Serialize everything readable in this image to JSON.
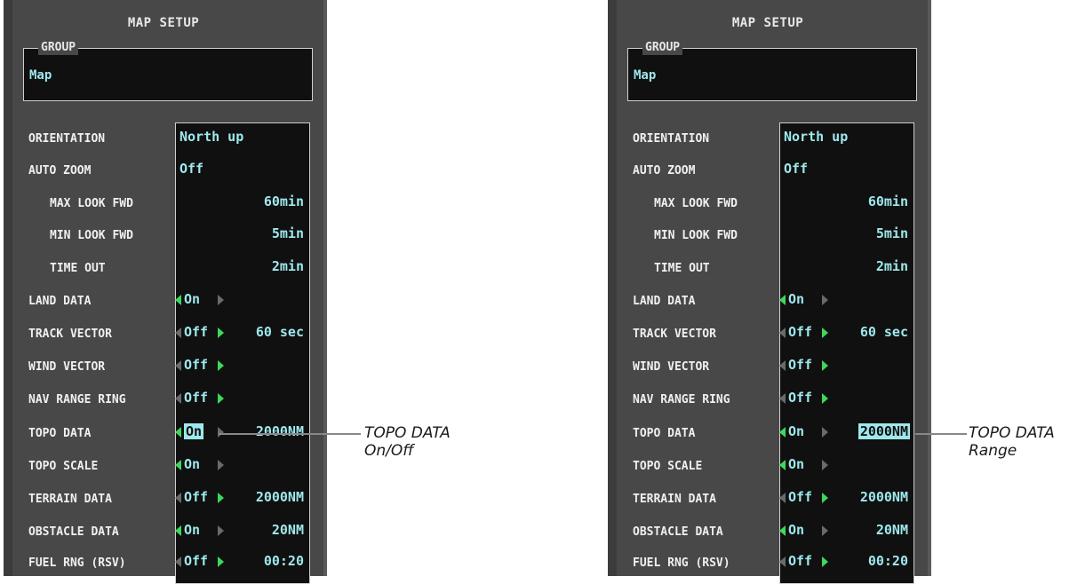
{
  "panels": [
    {
      "title": "MAP SETUP",
      "group_label": "GROUP",
      "group_value": "Map",
      "highlight": "topo_on",
      "rows": [
        {
          "label": "ORIENTATION",
          "value": "North up"
        },
        {
          "label": "AUTO ZOOM",
          "value": "Off"
        },
        {
          "label": "MAX LOOK FWD",
          "value": "60min"
        },
        {
          "label": "MIN LOOK FWD",
          "value": "5min"
        },
        {
          "label": "TIME OUT",
          "value": "2min"
        },
        {
          "label": "LAND DATA",
          "value": "On"
        },
        {
          "label": "TRACK VECTOR",
          "value": "Off",
          "range": "60 sec"
        },
        {
          "label": "WIND VECTOR",
          "value": "Off"
        },
        {
          "label": "NAV RANGE RING",
          "value": "Off"
        },
        {
          "label": "TOPO DATA",
          "value": "On",
          "range": "2000NM"
        },
        {
          "label": "TOPO SCALE",
          "value": "On"
        },
        {
          "label": "TERRAIN DATA",
          "value": "Off",
          "range": "2000NM"
        },
        {
          "label": "OBSTACLE DATA",
          "value": "On",
          "range": "20NM"
        },
        {
          "label": "FUEL RNG (RSV)",
          "value": "Off",
          "range": "00:20"
        }
      ],
      "callout_line1": "TOPO DATA",
      "callout_line2": "On/Off"
    },
    {
      "title": "MAP SETUP",
      "group_label": "GROUP",
      "group_value": "Map",
      "highlight": "topo_range",
      "rows": [
        {
          "label": "ORIENTATION",
          "value": "North up"
        },
        {
          "label": "AUTO ZOOM",
          "value": "Off"
        },
        {
          "label": "MAX LOOK FWD",
          "value": "60min"
        },
        {
          "label": "MIN LOOK FWD",
          "value": "5min"
        },
        {
          "label": "TIME OUT",
          "value": "2min"
        },
        {
          "label": "LAND DATA",
          "value": "On"
        },
        {
          "label": "TRACK VECTOR",
          "value": "Off",
          "range": "60 sec"
        },
        {
          "label": "WIND VECTOR",
          "value": "Off"
        },
        {
          "label": "NAV RANGE RING",
          "value": "Off"
        },
        {
          "label": "TOPO DATA",
          "value": "On",
          "range": "2000NM"
        },
        {
          "label": "TOPO SCALE",
          "value": "On"
        },
        {
          "label": "TERRAIN DATA",
          "value": "Off",
          "range": "2000NM"
        },
        {
          "label": "OBSTACLE DATA",
          "value": "On",
          "range": "20NM"
        },
        {
          "label": "FUEL RNG (RSV)",
          "value": "Off",
          "range": "00:20"
        }
      ],
      "callout_line1": "TOPO DATA",
      "callout_line2": "Range"
    }
  ],
  "colors": {
    "value_cyan": "#9ee8ec",
    "arrow_green": "#3ed85a",
    "arrow_gray": "#6a6a6a"
  }
}
